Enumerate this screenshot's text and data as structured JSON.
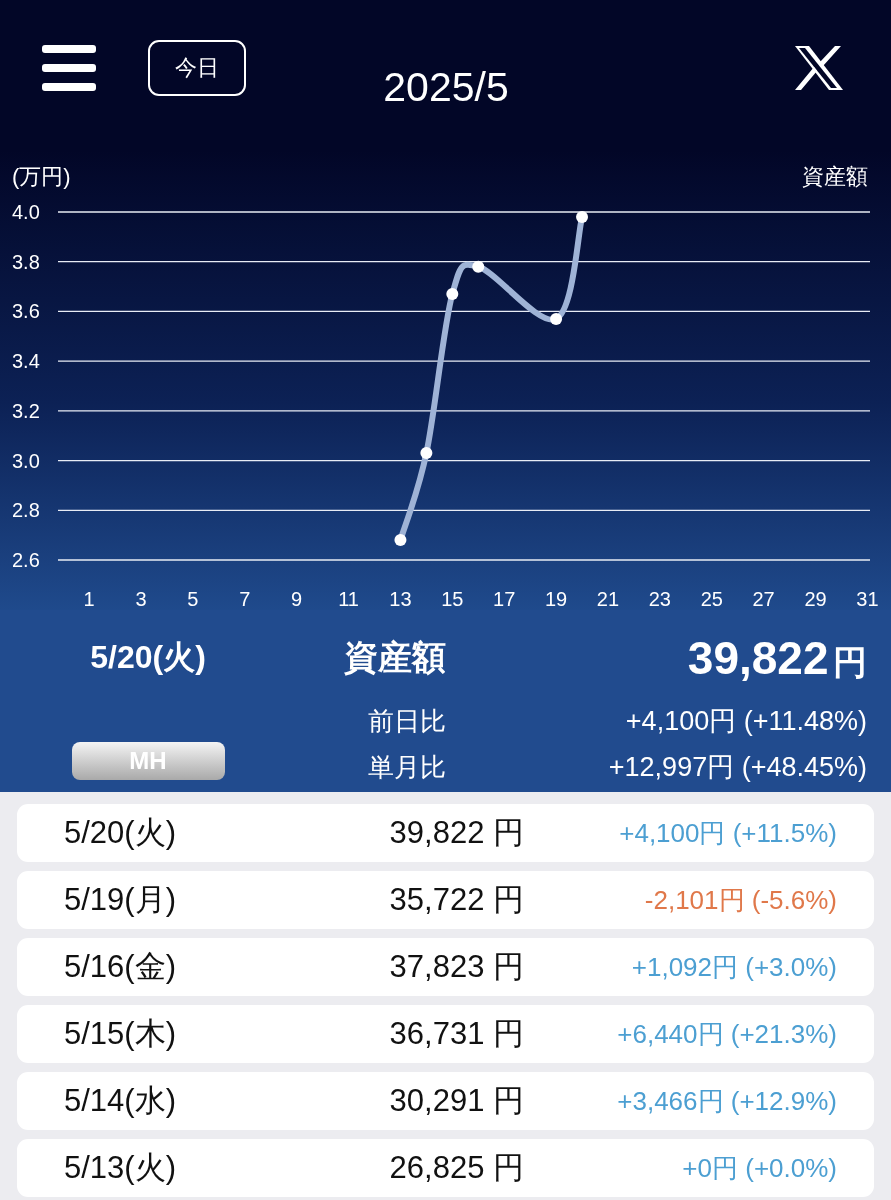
{
  "header": {
    "today_button": "今日",
    "title": "2025/5"
  },
  "chart": {
    "chart_data": {
      "type": "line",
      "ylabel": "(万円)",
      "grid": true,
      "x": [
        13,
        14,
        15,
        16,
        19,
        20
      ],
      "series": [
        {
          "name": "資産額",
          "color": "#9fb3d6",
          "marker": true,
          "values": [
            2.68,
            3.03,
            3.67,
            3.78,
            3.57,
            3.98
          ]
        }
      ],
      "xlim": [
        -0.2,
        31.1
      ],
      "ylim": [
        2.6,
        4.0
      ],
      "xticks": [
        1,
        3,
        5,
        7,
        9,
        11,
        13,
        15,
        17,
        19,
        21,
        23,
        25,
        27,
        29,
        31
      ],
      "yticks": [
        {
          "value": 4.0,
          "label": "4.0"
        },
        {
          "value": 3.8,
          "label": "3.8"
        },
        {
          "value": 3.6,
          "label": "3.6"
        },
        {
          "value": 3.4,
          "label": "3.4"
        },
        {
          "value": 3.2,
          "label": "3.2"
        },
        {
          "value": 3.0,
          "label": "3.0"
        },
        {
          "value": 2.8,
          "label": "2.8"
        },
        {
          "value": 2.6,
          "label": "2.6"
        }
      ]
    }
  },
  "summary": {
    "date": "5/20(火)",
    "label": "資産額",
    "amount": "39,822",
    "unit": "円",
    "mh_button": "MH",
    "comparisons": [
      {
        "label": "前日比",
        "value": "+4,100円 (+11.48%)"
      },
      {
        "label": "単月比",
        "value": "+12,997円 (+48.45%)"
      }
    ]
  },
  "rows": [
    {
      "date": "5/20(火)",
      "amount": "39,822 円",
      "change": "+4,100円 (+11.5%)",
      "color": "#4c9fd2"
    },
    {
      "date": "5/19(月)",
      "amount": "35,722 円",
      "change": "-2,101円 (-5.6%)",
      "color": "#e0784a"
    },
    {
      "date": "5/16(金)",
      "amount": "37,823 円",
      "change": "+1,092円 (+3.0%)",
      "color": "#4c9fd2"
    },
    {
      "date": "5/15(木)",
      "amount": "36,731 円",
      "change": "+6,440円 (+21.3%)",
      "color": "#4c9fd2"
    },
    {
      "date": "5/14(水)",
      "amount": "30,291 円",
      "change": "+3,466円 (+12.9%)",
      "color": "#4c9fd2"
    },
    {
      "date": "5/13(火)",
      "amount": "26,825 円",
      "change": "+0円 (+0.0%)",
      "color": "#4c9fd2"
    }
  ]
}
